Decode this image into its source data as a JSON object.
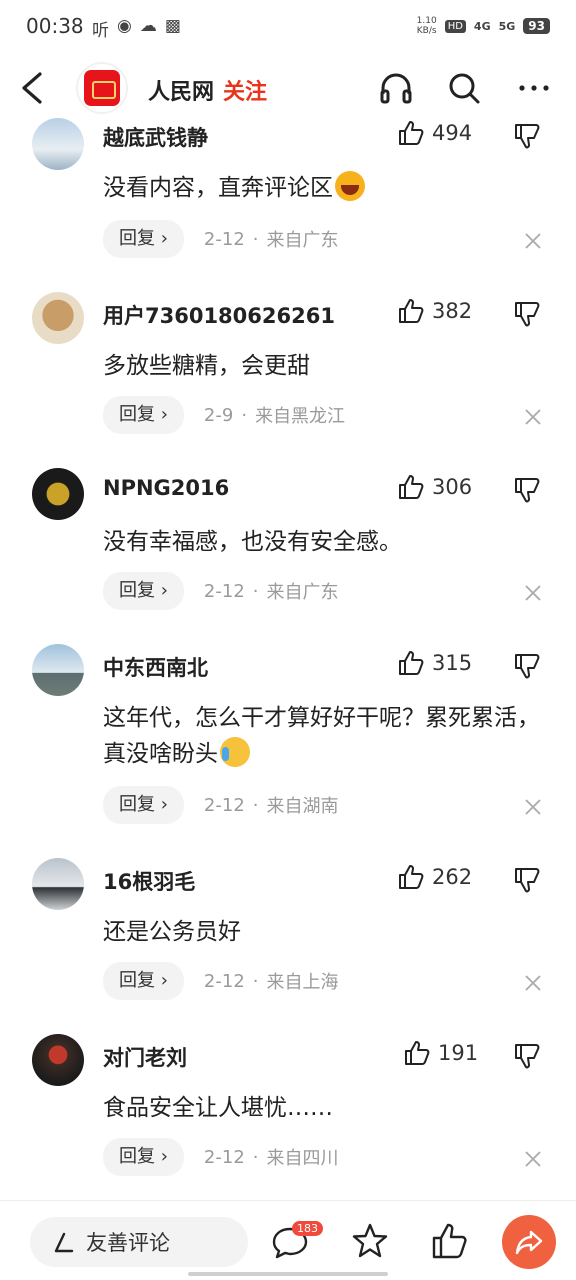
{
  "status_bar": {
    "time": "00:38",
    "left_icons": [
      "listen-icon",
      "chat-bubble-icon",
      "cloud-icon",
      "no-sim-icon"
    ],
    "net_speed_value": "1.10",
    "net_speed_unit": "KB/s",
    "hd_label": "HD",
    "signal_1": "4G",
    "signal_2": "5G",
    "battery": "93"
  },
  "header": {
    "channel_name": "人民网",
    "follow_label": "关注",
    "icons": [
      "back-icon",
      "headphones-icon",
      "search-icon",
      "more-icon"
    ]
  },
  "comments": [
    {
      "name": "越底武钱静",
      "likes": "494",
      "text": "没看内容，直奔评论区",
      "emoji": "laugh",
      "reply": "回复",
      "date": "2-12",
      "location": "来自广东"
    },
    {
      "name": "用户7360180626261",
      "likes": "382",
      "text": "多放些糖精，会更甜",
      "emoji": "",
      "reply": "回复",
      "date": "2-9",
      "location": "来自黑龙江"
    },
    {
      "name": "NPNG2016",
      "likes": "306",
      "text": "没有幸福感，也没有安全感。",
      "emoji": "",
      "reply": "回复",
      "date": "2-12",
      "location": "来自广东"
    },
    {
      "name": "中东西南北",
      "likes": "315",
      "text": "这年代，怎么干才算好好干呢？累死累活，真没啥盼头",
      "emoji": "cry",
      "reply": "回复",
      "date": "2-12",
      "location": "来自湖南"
    },
    {
      "name": "16根羽毛",
      "likes": "262",
      "text": "还是公务员好",
      "emoji": "",
      "reply": "回复",
      "date": "2-12",
      "location": "来自上海"
    },
    {
      "name": "对门老刘",
      "likes": "191",
      "text": "食品安全让人堪忧……",
      "emoji": "",
      "reply": "回复",
      "date": "2-12",
      "location": "来自四川"
    }
  ],
  "bottom_bar": {
    "input_placeholder": "友善评论",
    "comment_count": "183"
  },
  "colors": {
    "accent_red": "#e8341b",
    "share_button": "#f0613f",
    "badge_red": "#f04a3c"
  }
}
